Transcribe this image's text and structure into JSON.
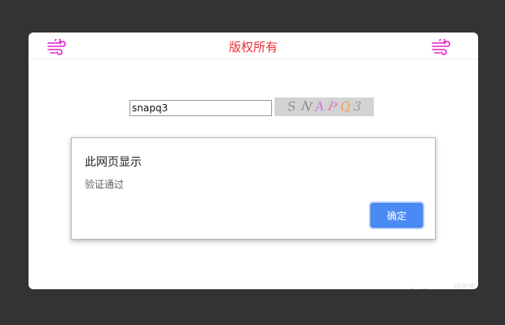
{
  "header": {
    "title": "版权所有",
    "left_icon": "wind-icon",
    "right_icon": "wind-icon",
    "title_color": "#e8313a",
    "icon_color": "#e020c8"
  },
  "captcha": {
    "input_value": "snapq3",
    "image_chars": [
      {
        "char": "S",
        "color": "#8f8f8f"
      },
      {
        "char": "N",
        "color": "#8a8a8a"
      },
      {
        "char": "A",
        "color": "#c77de0"
      },
      {
        "char": "P",
        "color": "#e07ab8"
      },
      {
        "char": "Q",
        "color": "#f0a04a"
      },
      {
        "char": "3",
        "color": "#9a9a9a"
      }
    ]
  },
  "dialog": {
    "title": "此网页显示",
    "message": "验证通过",
    "ok_label": "确定",
    "button_color": "#4a8af4"
  },
  "watermark": {
    "text": "jQuery",
    "subtext": "插件库"
  }
}
